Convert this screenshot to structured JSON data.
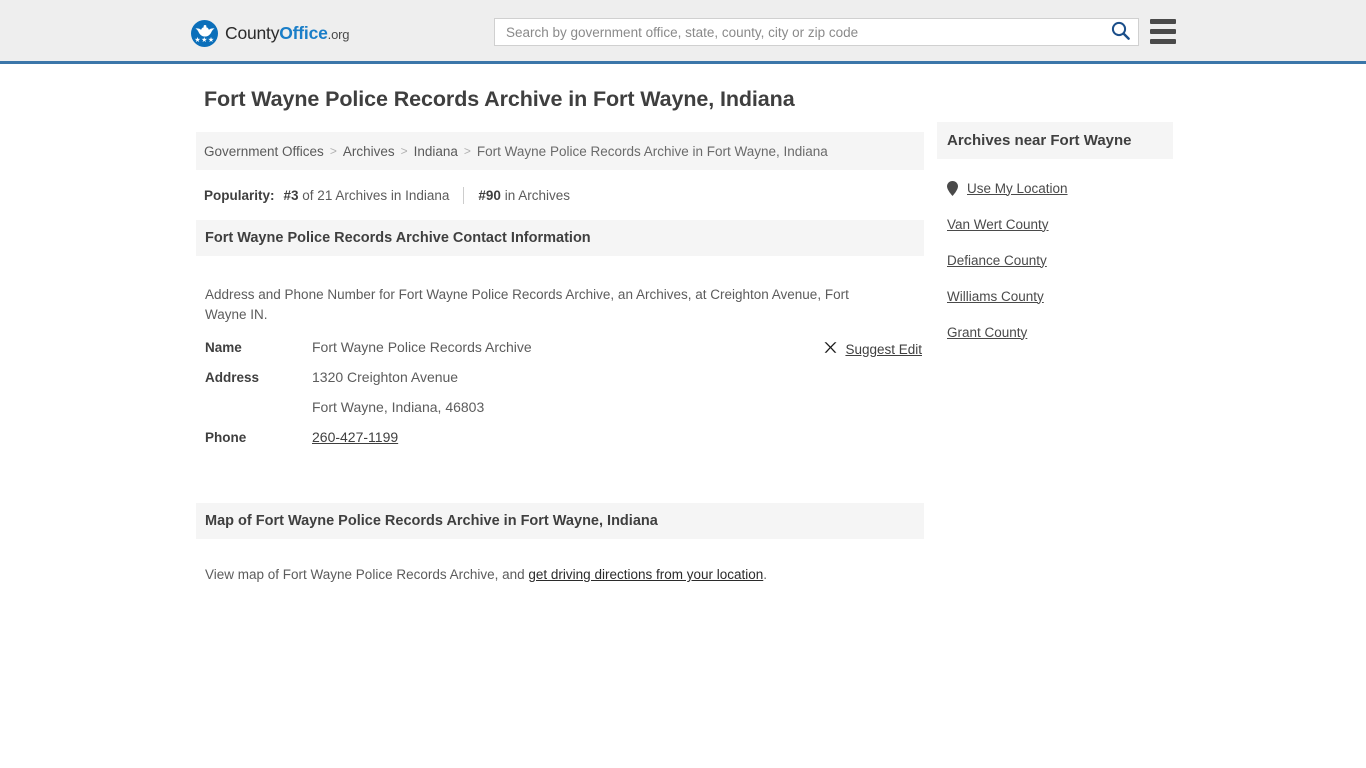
{
  "header": {
    "logo": {
      "text_1": "County",
      "text_2": "Office",
      "text_3": ".org",
      "icon": "eagle-seal-icon"
    },
    "search": {
      "placeholder": "Search by government office, state, county, city or zip code",
      "value": "",
      "icon": "search-icon"
    },
    "menu_icon": "hamburger-menu-icon",
    "accent_color": "#3b76a9",
    "background_color": "#eeeeee"
  },
  "main": {
    "title": "Fort Wayne Police Records Archive in Fort Wayne, Indiana",
    "breadcrumb": {
      "items": [
        {
          "label": "Government Offices"
        },
        {
          "label": "Archives"
        },
        {
          "label": "Indiana"
        },
        {
          "label": "Fort Wayne Police Records Archive in Fort Wayne, Indiana"
        }
      ],
      "separator": ">"
    },
    "popularity": {
      "label": "Popularity:",
      "rank_state_rank": "#3",
      "rank_state_rest": " of 21 Archives in Indiana",
      "rank_national_rank": "#90",
      "rank_national_rest": " in Archives"
    },
    "contact_section": {
      "heading": "Fort Wayne Police Records Archive Contact Information",
      "description": "Address and Phone Number for Fort Wayne Police Records Archive, an Archives, at Creighton Avenue, Fort Wayne IN.",
      "rows": [
        {
          "key": "Name",
          "value": "Fort Wayne Police Records Archive"
        },
        {
          "key": "Address",
          "value": "1320 Creighton Avenue"
        },
        {
          "key": "",
          "value": "Fort Wayne, Indiana, 46803"
        },
        {
          "key": "Phone",
          "value": "260-427-1199"
        }
      ],
      "suggest_edit": {
        "label": "Suggest Edit",
        "icon": "edit-pencil-icon"
      }
    },
    "map_section": {
      "heading": "Map of Fort Wayne Police Records Archive in Fort Wayne, Indiana",
      "text_before": "View map of Fort Wayne Police Records Archive, and ",
      "link": "get driving directions from your location",
      "text_after": "."
    }
  },
  "sidebar": {
    "heading": "Archives near Fort Wayne",
    "items": [
      {
        "label": "Use My Location",
        "icon": "map-pin-icon"
      },
      {
        "label": "Van Wert County",
        "icon": ""
      },
      {
        "label": "Defiance County",
        "icon": ""
      },
      {
        "label": "Williams County",
        "icon": ""
      },
      {
        "label": "Grant County",
        "icon": ""
      }
    ]
  }
}
